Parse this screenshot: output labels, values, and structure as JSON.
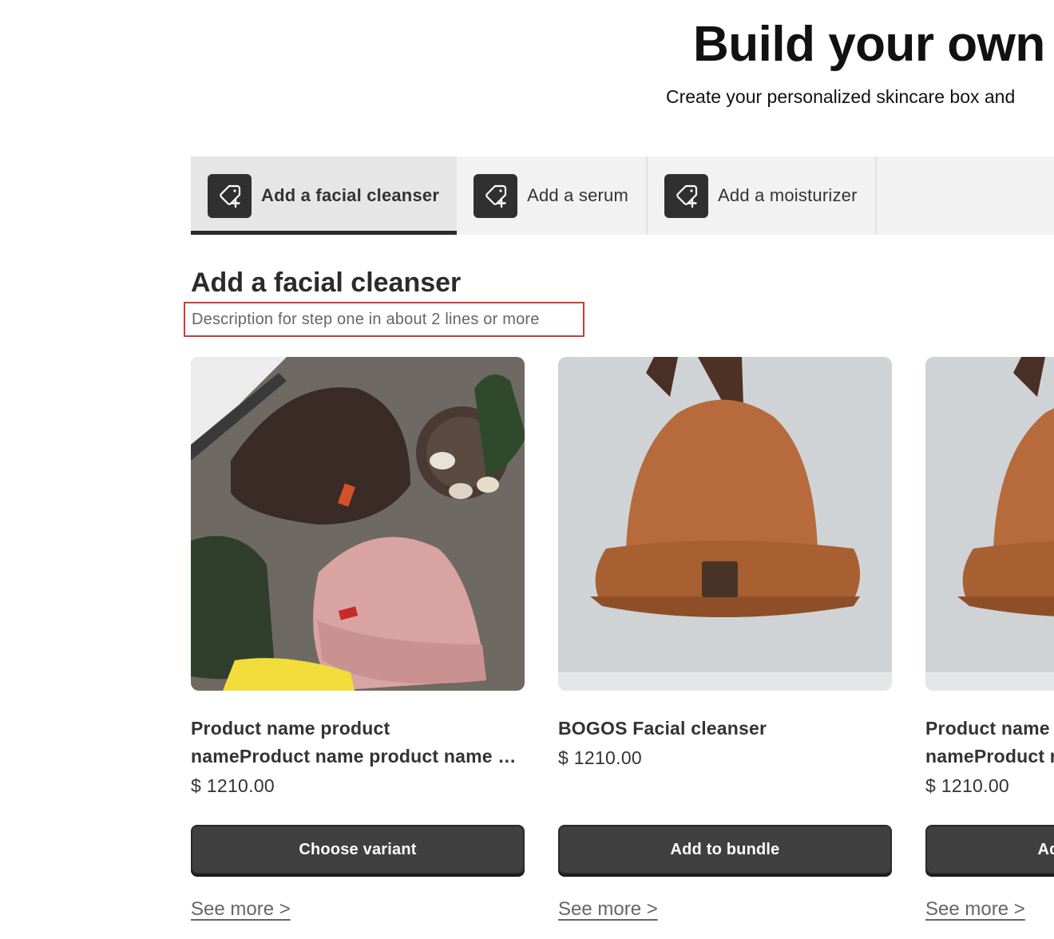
{
  "hero": {
    "title": "Build your own",
    "subtitle": "Create your personalized skincare box and"
  },
  "tabs": [
    {
      "label": "Add a facial cleanser",
      "icon": "tag-plus-icon",
      "active": true
    },
    {
      "label": "Add a serum",
      "icon": "tag-plus-icon",
      "active": false
    },
    {
      "label": "Add a moisturizer",
      "icon": "tag-plus-icon",
      "active": false
    }
  ],
  "step": {
    "title": "Add a facial cleanser",
    "description": "Description for step one in about 2 lines or more"
  },
  "products": [
    {
      "name_line1": "Product name product",
      "name_line2": "nameProduct name product name product name",
      "price": "$ 1210.00",
      "button": "Choose variant",
      "see_more": "See more >"
    },
    {
      "name_line1": "BOGOS Facial cleanser",
      "name_line2": "",
      "price": "$ 1210.00",
      "button": "Add to bundle",
      "see_more": "See more >"
    },
    {
      "name_line1": "Product name product",
      "name_line2": "nameProduct name product name product name",
      "price": "$ 1210.00",
      "button": "Add to bundle",
      "see_more": "See more >"
    }
  ],
  "colors": {
    "accent_dark": "#303030",
    "button": "#404040",
    "highlight_border": "#d23b2f",
    "tab_bg": "#f2f2f2"
  }
}
